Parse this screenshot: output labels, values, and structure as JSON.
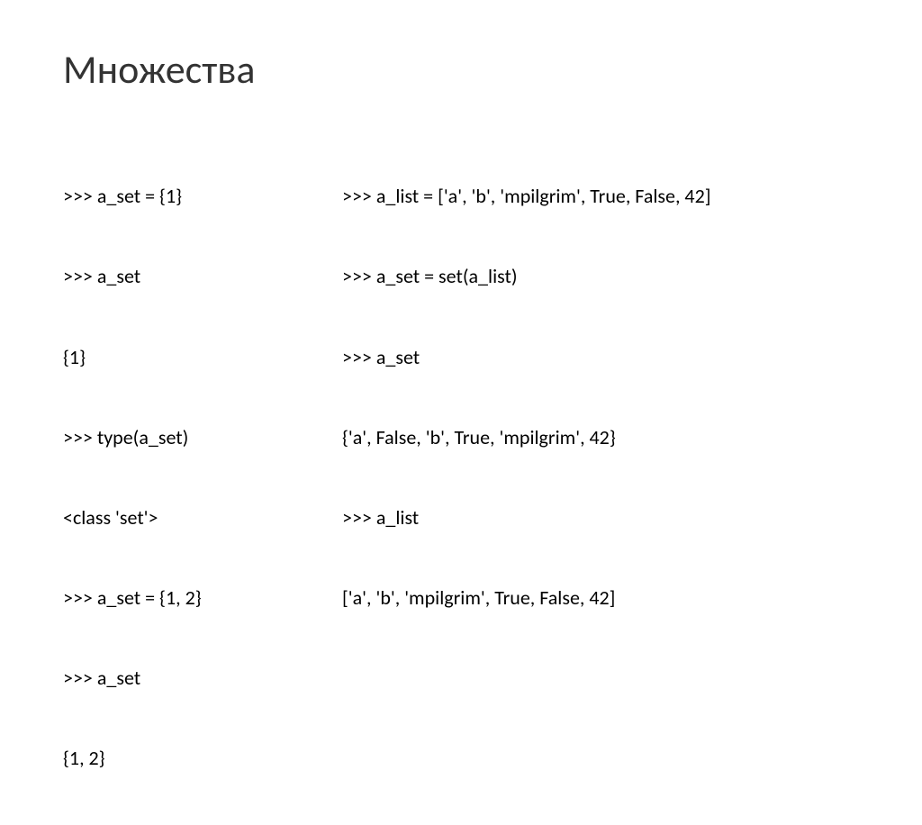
{
  "title": "Множества",
  "left": {
    "lines": [
      ">>> a_set = {1}",
      ">>> a_set",
      "{1}",
      ">>> type(a_set)",
      "<class 'set'>",
      ">>> a_set = {1, 2}",
      ">>> a_set",
      "{1, 2}"
    ]
  },
  "right": {
    "lines": [
      ">>> a_list = ['a', 'b', 'mpilgrim', True, False, 42]",
      ">>> a_set = set(a_list)",
      ">>> a_set",
      "{'a', False, 'b', True, 'mpilgrim', 42}",
      ">>> a_list",
      "['a', 'b', 'mpilgrim', True, False, 42]"
    ]
  }
}
